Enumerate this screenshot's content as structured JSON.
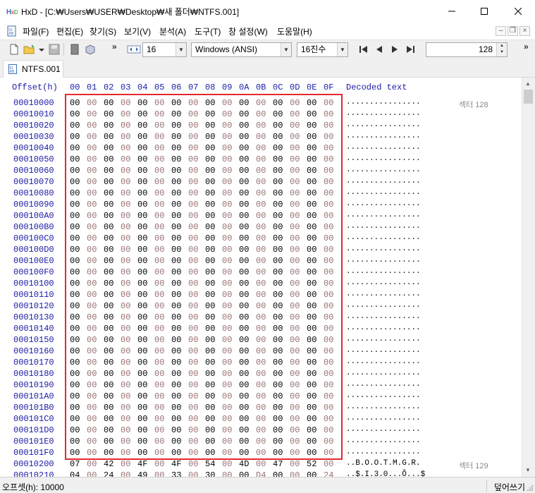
{
  "window": {
    "title": "HxD - [C:₩Users₩USER₩Desktop₩새 폴더₩NTFS.001]",
    "minimize": "─",
    "maximize": "☐",
    "close": "✕"
  },
  "menu": [
    "파일(F)",
    "편집(E)",
    "찾기(S)",
    "보기(V)",
    "분석(A)",
    "도구(T)",
    "창 설정(W)",
    "도움말(H)"
  ],
  "mdi": {
    "minimize": "–",
    "restore": "❐",
    "close": "×"
  },
  "toolbar": {
    "bytes_per_row": "16",
    "charset": "Windows (ANSI)",
    "offset_base": "16진수",
    "sector_value": "128",
    "chevron": "»"
  },
  "tab": {
    "label": "NTFS.001"
  },
  "hex": {
    "offset_header": "Offset(h)",
    "columns": [
      "00",
      "01",
      "02",
      "03",
      "04",
      "05",
      "06",
      "07",
      "08",
      "09",
      "0A",
      "0B",
      "0C",
      "0D",
      "0E",
      "0F"
    ],
    "decoded_header": "Decoded text",
    "rows": [
      {
        "offset": "00010000",
        "bytes": [
          "00",
          "00",
          "00",
          "00",
          "00",
          "00",
          "00",
          "00",
          "00",
          "00",
          "00",
          "00",
          "00",
          "00",
          "00",
          "00"
        ],
        "text": "................",
        "sector": "섹터 128"
      },
      {
        "offset": "00010010",
        "bytes": [
          "00",
          "00",
          "00",
          "00",
          "00",
          "00",
          "00",
          "00",
          "00",
          "00",
          "00",
          "00",
          "00",
          "00",
          "00",
          "00"
        ],
        "text": "................"
      },
      {
        "offset": "00010020",
        "bytes": [
          "00",
          "00",
          "00",
          "00",
          "00",
          "00",
          "00",
          "00",
          "00",
          "00",
          "00",
          "00",
          "00",
          "00",
          "00",
          "00"
        ],
        "text": "................"
      },
      {
        "offset": "00010030",
        "bytes": [
          "00",
          "00",
          "00",
          "00",
          "00",
          "00",
          "00",
          "00",
          "00",
          "00",
          "00",
          "00",
          "00",
          "00",
          "00",
          "00"
        ],
        "text": "................"
      },
      {
        "offset": "00010040",
        "bytes": [
          "00",
          "00",
          "00",
          "00",
          "00",
          "00",
          "00",
          "00",
          "00",
          "00",
          "00",
          "00",
          "00",
          "00",
          "00",
          "00"
        ],
        "text": "................"
      },
      {
        "offset": "00010050",
        "bytes": [
          "00",
          "00",
          "00",
          "00",
          "00",
          "00",
          "00",
          "00",
          "00",
          "00",
          "00",
          "00",
          "00",
          "00",
          "00",
          "00"
        ],
        "text": "................"
      },
      {
        "offset": "00010060",
        "bytes": [
          "00",
          "00",
          "00",
          "00",
          "00",
          "00",
          "00",
          "00",
          "00",
          "00",
          "00",
          "00",
          "00",
          "00",
          "00",
          "00"
        ],
        "text": "................"
      },
      {
        "offset": "00010070",
        "bytes": [
          "00",
          "00",
          "00",
          "00",
          "00",
          "00",
          "00",
          "00",
          "00",
          "00",
          "00",
          "00",
          "00",
          "00",
          "00",
          "00"
        ],
        "text": "................"
      },
      {
        "offset": "00010080",
        "bytes": [
          "00",
          "00",
          "00",
          "00",
          "00",
          "00",
          "00",
          "00",
          "00",
          "00",
          "00",
          "00",
          "00",
          "00",
          "00",
          "00"
        ],
        "text": "................"
      },
      {
        "offset": "00010090",
        "bytes": [
          "00",
          "00",
          "00",
          "00",
          "00",
          "00",
          "00",
          "00",
          "00",
          "00",
          "00",
          "00",
          "00",
          "00",
          "00",
          "00"
        ],
        "text": "................"
      },
      {
        "offset": "000100A0",
        "bytes": [
          "00",
          "00",
          "00",
          "00",
          "00",
          "00",
          "00",
          "00",
          "00",
          "00",
          "00",
          "00",
          "00",
          "00",
          "00",
          "00"
        ],
        "text": "................"
      },
      {
        "offset": "000100B0",
        "bytes": [
          "00",
          "00",
          "00",
          "00",
          "00",
          "00",
          "00",
          "00",
          "00",
          "00",
          "00",
          "00",
          "00",
          "00",
          "00",
          "00"
        ],
        "text": "................"
      },
      {
        "offset": "000100C0",
        "bytes": [
          "00",
          "00",
          "00",
          "00",
          "00",
          "00",
          "00",
          "00",
          "00",
          "00",
          "00",
          "00",
          "00",
          "00",
          "00",
          "00"
        ],
        "text": "................"
      },
      {
        "offset": "000100D0",
        "bytes": [
          "00",
          "00",
          "00",
          "00",
          "00",
          "00",
          "00",
          "00",
          "00",
          "00",
          "00",
          "00",
          "00",
          "00",
          "00",
          "00"
        ],
        "text": "................"
      },
      {
        "offset": "000100E0",
        "bytes": [
          "00",
          "00",
          "00",
          "00",
          "00",
          "00",
          "00",
          "00",
          "00",
          "00",
          "00",
          "00",
          "00",
          "00",
          "00",
          "00"
        ],
        "text": "................"
      },
      {
        "offset": "000100F0",
        "bytes": [
          "00",
          "00",
          "00",
          "00",
          "00",
          "00",
          "00",
          "00",
          "00",
          "00",
          "00",
          "00",
          "00",
          "00",
          "00",
          "00"
        ],
        "text": "................"
      },
      {
        "offset": "00010100",
        "bytes": [
          "00",
          "00",
          "00",
          "00",
          "00",
          "00",
          "00",
          "00",
          "00",
          "00",
          "00",
          "00",
          "00",
          "00",
          "00",
          "00"
        ],
        "text": "................"
      },
      {
        "offset": "00010110",
        "bytes": [
          "00",
          "00",
          "00",
          "00",
          "00",
          "00",
          "00",
          "00",
          "00",
          "00",
          "00",
          "00",
          "00",
          "00",
          "00",
          "00"
        ],
        "text": "................"
      },
      {
        "offset": "00010120",
        "bytes": [
          "00",
          "00",
          "00",
          "00",
          "00",
          "00",
          "00",
          "00",
          "00",
          "00",
          "00",
          "00",
          "00",
          "00",
          "00",
          "00"
        ],
        "text": "................"
      },
      {
        "offset": "00010130",
        "bytes": [
          "00",
          "00",
          "00",
          "00",
          "00",
          "00",
          "00",
          "00",
          "00",
          "00",
          "00",
          "00",
          "00",
          "00",
          "00",
          "00"
        ],
        "text": "................"
      },
      {
        "offset": "00010140",
        "bytes": [
          "00",
          "00",
          "00",
          "00",
          "00",
          "00",
          "00",
          "00",
          "00",
          "00",
          "00",
          "00",
          "00",
          "00",
          "00",
          "00"
        ],
        "text": "................"
      },
      {
        "offset": "00010150",
        "bytes": [
          "00",
          "00",
          "00",
          "00",
          "00",
          "00",
          "00",
          "00",
          "00",
          "00",
          "00",
          "00",
          "00",
          "00",
          "00",
          "00"
        ],
        "text": "................"
      },
      {
        "offset": "00010160",
        "bytes": [
          "00",
          "00",
          "00",
          "00",
          "00",
          "00",
          "00",
          "00",
          "00",
          "00",
          "00",
          "00",
          "00",
          "00",
          "00",
          "00"
        ],
        "text": "................"
      },
      {
        "offset": "00010170",
        "bytes": [
          "00",
          "00",
          "00",
          "00",
          "00",
          "00",
          "00",
          "00",
          "00",
          "00",
          "00",
          "00",
          "00",
          "00",
          "00",
          "00"
        ],
        "text": "................"
      },
      {
        "offset": "00010180",
        "bytes": [
          "00",
          "00",
          "00",
          "00",
          "00",
          "00",
          "00",
          "00",
          "00",
          "00",
          "00",
          "00",
          "00",
          "00",
          "00",
          "00"
        ],
        "text": "................"
      },
      {
        "offset": "00010190",
        "bytes": [
          "00",
          "00",
          "00",
          "00",
          "00",
          "00",
          "00",
          "00",
          "00",
          "00",
          "00",
          "00",
          "00",
          "00",
          "00",
          "00"
        ],
        "text": "................"
      },
      {
        "offset": "000101A0",
        "bytes": [
          "00",
          "00",
          "00",
          "00",
          "00",
          "00",
          "00",
          "00",
          "00",
          "00",
          "00",
          "00",
          "00",
          "00",
          "00",
          "00"
        ],
        "text": "................"
      },
      {
        "offset": "000101B0",
        "bytes": [
          "00",
          "00",
          "00",
          "00",
          "00",
          "00",
          "00",
          "00",
          "00",
          "00",
          "00",
          "00",
          "00",
          "00",
          "00",
          "00"
        ],
        "text": "................"
      },
      {
        "offset": "000101C0",
        "bytes": [
          "00",
          "00",
          "00",
          "00",
          "00",
          "00",
          "00",
          "00",
          "00",
          "00",
          "00",
          "00",
          "00",
          "00",
          "00",
          "00"
        ],
        "text": "................"
      },
      {
        "offset": "000101D0",
        "bytes": [
          "00",
          "00",
          "00",
          "00",
          "00",
          "00",
          "00",
          "00",
          "00",
          "00",
          "00",
          "00",
          "00",
          "00",
          "00",
          "00"
        ],
        "text": "................"
      },
      {
        "offset": "000101E0",
        "bytes": [
          "00",
          "00",
          "00",
          "00",
          "00",
          "00",
          "00",
          "00",
          "00",
          "00",
          "00",
          "00",
          "00",
          "00",
          "00",
          "00"
        ],
        "text": "................"
      },
      {
        "offset": "000101F0",
        "bytes": [
          "00",
          "00",
          "00",
          "00",
          "00",
          "00",
          "00",
          "00",
          "00",
          "00",
          "00",
          "00",
          "00",
          "00",
          "00",
          "00"
        ],
        "text": "................"
      },
      {
        "offset": "00010200",
        "bytes": [
          "07",
          "00",
          "42",
          "00",
          "4F",
          "00",
          "4F",
          "00",
          "54",
          "00",
          "4D",
          "00",
          "47",
          "00",
          "52",
          "00"
        ],
        "text": "..B.O.O.T.M.G.R.",
        "sector": "섹터 129"
      },
      {
        "offset": "00010210",
        "bytes": [
          "04",
          "00",
          "24",
          "00",
          "49",
          "00",
          "33",
          "00",
          "30",
          "00",
          "00",
          "D4",
          "00",
          "00",
          "00",
          "24"
        ],
        "text": "..$.I.3.0...Ô...$"
      }
    ]
  },
  "status": {
    "offset": "오프셋(h): 10000",
    "mode": "덮어쓰기"
  },
  "colors": {
    "highlight_box": "#e5282d",
    "offset_blue": "#1a1aa6",
    "odd_byte": "#9a7070"
  }
}
